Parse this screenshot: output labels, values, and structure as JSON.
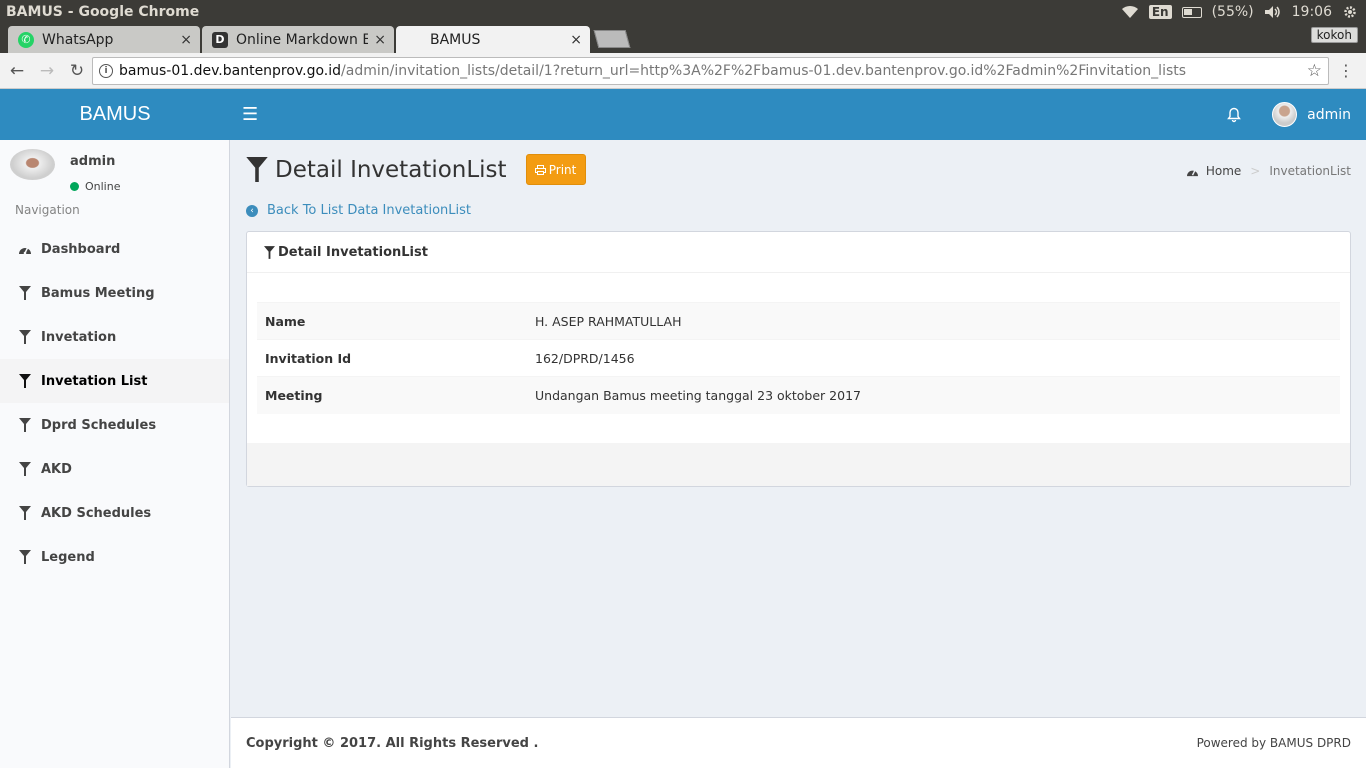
{
  "os": {
    "window_title": "BAMUS - Google Chrome",
    "lang": "En",
    "battery": "(55%)",
    "time": "19:06"
  },
  "browser": {
    "tabs": [
      {
        "label": "WhatsApp",
        "close": "×"
      },
      {
        "label": "Online Markdown E",
        "close": "×"
      },
      {
        "label": "BAMUS",
        "close": "×"
      }
    ],
    "profile": "kokoh",
    "url_host": "bamus-01.dev.bantenprov.go.id",
    "url_path": "/admin/invitation_lists/detail/1?return_url=http%3A%2F%2Fbamus-01.dev.bantenprov.go.id%2Fadmin%2Finvitation_lists"
  },
  "header": {
    "brand": "BAMUS",
    "user": "admin"
  },
  "sidebar": {
    "user_name": "admin",
    "status": "Online",
    "nav_header": "Navigation",
    "items": [
      {
        "label": "Dashboard",
        "icon": "dashboard-icon"
      },
      {
        "label": "Bamus Meeting",
        "icon": "filter-icon"
      },
      {
        "label": "Invetation",
        "icon": "filter-icon"
      },
      {
        "label": "Invetation List",
        "icon": "filter-icon",
        "active": true
      },
      {
        "label": "Dprd Schedules",
        "icon": "filter-icon"
      },
      {
        "label": "AKD",
        "icon": "filter-icon"
      },
      {
        "label": "AKD Schedules",
        "icon": "filter-icon"
      },
      {
        "label": "Legend",
        "icon": "filter-icon"
      }
    ]
  },
  "main": {
    "title": "Detail InvetationList",
    "print_label": "Print",
    "breadcrumb_home": "Home",
    "breadcrumb_sep": ">",
    "breadcrumb_current": "InvetationList",
    "back_link": "Back To List Data InvetationList",
    "box_title": "Detail InvetationList",
    "rows": [
      {
        "key": "Name",
        "value": "H. ASEP RAHMATULLAH"
      },
      {
        "key": "Invitation Id",
        "value": "162/DPRD/1456"
      },
      {
        "key": "Meeting",
        "value": "Undangan Bamus meeting tanggal 23 oktober 2017"
      }
    ]
  },
  "footer": {
    "copyright": "Copyright © 2017. All Rights Reserved .",
    "powered": "Powered by BAMUS DPRD"
  },
  "colors": {
    "header_bg": "#2e8bc0",
    "print_button": "#f39c12",
    "link": "#3c8dbc",
    "online": "#00a65a"
  }
}
